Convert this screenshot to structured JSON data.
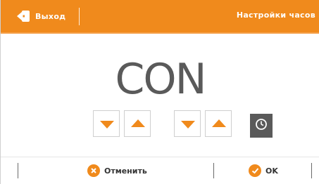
{
  "header": {
    "back_label": "Выход",
    "title": "Настройки часов"
  },
  "display": {
    "value": "CON"
  },
  "controls": {
    "group1": {
      "down_icon": "arrow-down",
      "up_icon": "arrow-up"
    },
    "group2": {
      "down_icon": "arrow-down",
      "up_icon": "arrow-up"
    },
    "clock_icon": "clock"
  },
  "footer": {
    "cancel_label": "Отменить",
    "ok_label": "OK"
  },
  "colors": {
    "accent": "#f08a1c",
    "display_text": "#5a5a5a",
    "clock_button": "#5a5a5a"
  }
}
